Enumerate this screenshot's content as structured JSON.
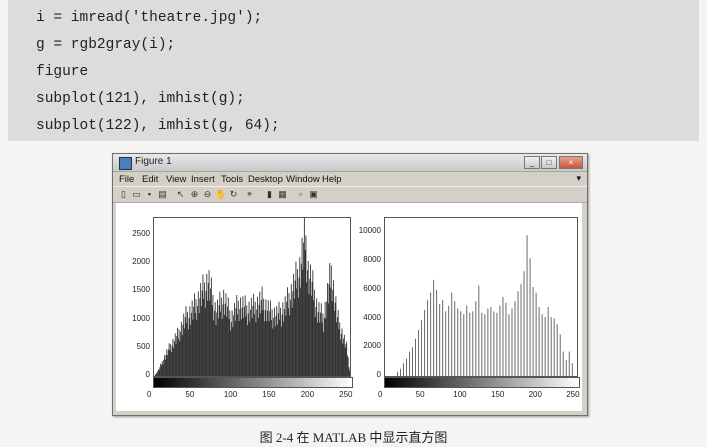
{
  "code": [
    "i = imread('theatre.jpg');",
    "g = rgb2gray(i);",
    "figure",
    "subplot(121), imhist(g);",
    "subplot(122), imhist(g, 64);"
  ],
  "window": {
    "title": "Figure 1",
    "menus": [
      "File",
      "Edit",
      "View",
      "Insert",
      "Tools",
      "Desktop",
      "Window",
      "Help"
    ],
    "controls": {
      "minimize": "_",
      "maximize": "□",
      "close": "×"
    }
  },
  "toolbar_icons": [
    "new-figure-icon",
    "open-icon",
    "save-icon",
    "print-icon",
    "pointer-icon",
    "zoom-in-icon",
    "zoom-out-icon",
    "pan-icon",
    "rotate-icon",
    "data-cursor-icon",
    "colorbar-icon",
    "legend-icon",
    "hide-plot-tools-icon",
    "show-plot-tools-icon"
  ],
  "chart_data": [
    {
      "type": "bar",
      "title": "",
      "bins": 256,
      "xlim": [
        0,
        255
      ],
      "ylim": [
        0,
        2800
      ],
      "yticks": [
        0,
        500,
        1000,
        1500,
        2000,
        2500
      ],
      "xticks": [
        0,
        50,
        100,
        150,
        200,
        250
      ],
      "grid": false,
      "profile_x": [
        0,
        6,
        12,
        20,
        30,
        40,
        50,
        60,
        70,
        80,
        90,
        100,
        110,
        120,
        130,
        140,
        150,
        160,
        170,
        180,
        190,
        196,
        200,
        205,
        212,
        220,
        230,
        238,
        245,
        250,
        255
      ],
      "profile_y": [
        0,
        120,
        300,
        500,
        700,
        1000,
        1150,
        1400,
        1650,
        1100,
        1350,
        1000,
        1250,
        1150,
        1200,
        1300,
        1100,
        1050,
        1200,
        1500,
        1900,
        2450,
        1800,
        1600,
        1150,
        1000,
        1800,
        1000,
        700,
        500,
        0
      ]
    },
    {
      "type": "bar",
      "title": "",
      "bins": 64,
      "xlim": [
        0,
        255
      ],
      "ylim": [
        0,
        11000
      ],
      "yticks": [
        0,
        2000,
        4000,
        6000,
        8000,
        10000
      ],
      "xticks": [
        0,
        50,
        100,
        150,
        200,
        250
      ],
      "grid": false,
      "values": [
        0,
        0,
        0,
        0,
        300,
        500,
        900,
        1200,
        1700,
        2000,
        2600,
        3200,
        3900,
        4600,
        5300,
        5800,
        6700,
        6000,
        5000,
        5300,
        4500,
        4900,
        5800,
        5200,
        4700,
        4500,
        4300,
        4900,
        4400,
        4500,
        5200,
        6300,
        4400,
        4300,
        4700,
        4800,
        4500,
        4400,
        4900,
        5500,
        5100,
        4300,
        4700,
        5200,
        5900,
        6400,
        7300,
        9800,
        8200,
        6200,
        5800,
        4800,
        4300,
        4100,
        4800,
        4100,
        4000,
        3600,
        2900,
        1700,
        1100,
        1700,
        900,
        0
      ]
    }
  ],
  "caption": "图 2-4   在 MATLAB 中显示直方图"
}
